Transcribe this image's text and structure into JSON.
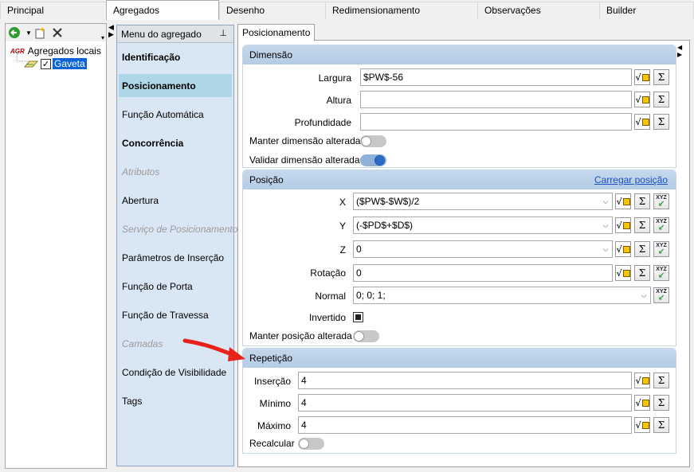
{
  "top_tabs": [
    "Principal",
    "Agregados",
    "Desenho",
    "Redimensionamento",
    "Observações",
    "Builder"
  ],
  "active_top_tab": "Agregados",
  "tree": {
    "root_prefix": "AGR",
    "root_label": "Agregados locais",
    "child_label": "Gaveta",
    "child_checked": true
  },
  "menu": {
    "header": "Menu do agregado",
    "items": [
      {
        "label": "Identificação",
        "style": "bold"
      },
      {
        "label": "Posicionamento",
        "style": "bold selected"
      },
      {
        "label": "Função Automática",
        "style": "normal"
      },
      {
        "label": "Concorrência",
        "style": "bold"
      },
      {
        "label": "Atributos",
        "style": "disabled"
      },
      {
        "label": "Abertura",
        "style": "normal"
      },
      {
        "label": "Serviço de Posicionamento",
        "style": "disabled"
      },
      {
        "label": "Parâmetros de Inserção",
        "style": "normal"
      },
      {
        "label": "Função de Porta",
        "style": "normal"
      },
      {
        "label": "Função de Travessa",
        "style": "normal"
      },
      {
        "label": "Camadas",
        "style": "disabled"
      },
      {
        "label": "Condição de Visibilidade",
        "style": "normal"
      },
      {
        "label": "Tags",
        "style": "normal"
      }
    ]
  },
  "content_tab": "Posicionamento",
  "dimensao": {
    "title": "Dimensão",
    "largura_label": "Largura",
    "largura_value": "$PW$-56",
    "altura_label": "Altura",
    "altura_value": "",
    "profundidade_label": "Profundidade",
    "profundidade_value": "",
    "manter_label": "Manter dimensão alterada",
    "manter_on": false,
    "validar_label": "Validar dimensão alterada",
    "validar_on": true
  },
  "posicao": {
    "title": "Posição",
    "link": "Carregar posição",
    "x_label": "X",
    "x_value": "($PW$-$W$)/2",
    "y_label": "Y",
    "y_value": "(-$PD$+$D$)",
    "z_label": "Z",
    "z_value": "0",
    "rotacao_label": "Rotação",
    "rotacao_value": "0",
    "normal_label": "Normal",
    "normal_value": "0; 0; 1;",
    "invertido_label": "Invertido",
    "invertido_checked": true,
    "manter_label": "Manter posição alterada",
    "manter_on": false
  },
  "repeticao": {
    "title": "Repetição",
    "insercao_label": "Inserção",
    "insercao_value": "4",
    "minimo_label": "Mínimo",
    "minimo_value": "4",
    "maximo_label": "Máximo",
    "maximo_value": "4",
    "recalcular_label": "Recalcular",
    "recalcular_on": false
  },
  "button_glyphs": {
    "formula": "√",
    "sum": "Σ",
    "xyz": "XYZ"
  },
  "colors": {
    "selected_menu": "#add7e6",
    "section_header": "#b4cce6",
    "toggle_on": "#2a6cc7",
    "link": "#1a4fc4",
    "annotation_arrow": "#e8211b"
  }
}
